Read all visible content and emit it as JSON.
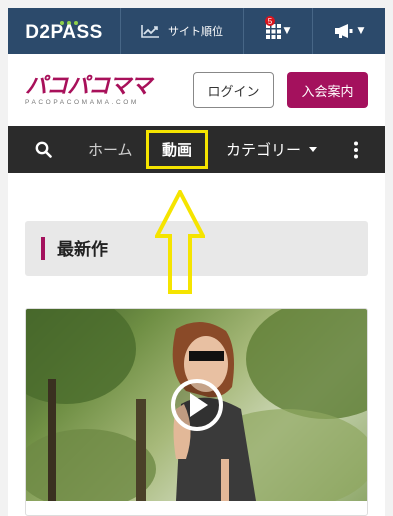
{
  "topbar": {
    "brand": "D2PASS",
    "rank_label": "サイト順位",
    "apps_badge": "5",
    "colors": {
      "bg": "#2c4a6b",
      "dots": "#8fd14a",
      "badge": "#d8141d"
    }
  },
  "header": {
    "brand_main": "パコパコママ",
    "brand_sub": "PACOPACOMAMA.COM",
    "login_label": "ログイン",
    "join_label": "入会案内",
    "colors": {
      "brand": "#a8105a",
      "join_bg": "#a4115d"
    }
  },
  "nav": {
    "home": "ホーム",
    "video": "動画",
    "category": "カテゴリー",
    "highlight_color": "#f5e400"
  },
  "main": {
    "section_title": "最新作"
  },
  "icons": [
    "chart-up-icon",
    "apps-grid-icon",
    "megaphone-icon",
    "search-icon",
    "more-vertical-icon",
    "play-icon",
    "up-arrow-annotation-icon"
  ]
}
